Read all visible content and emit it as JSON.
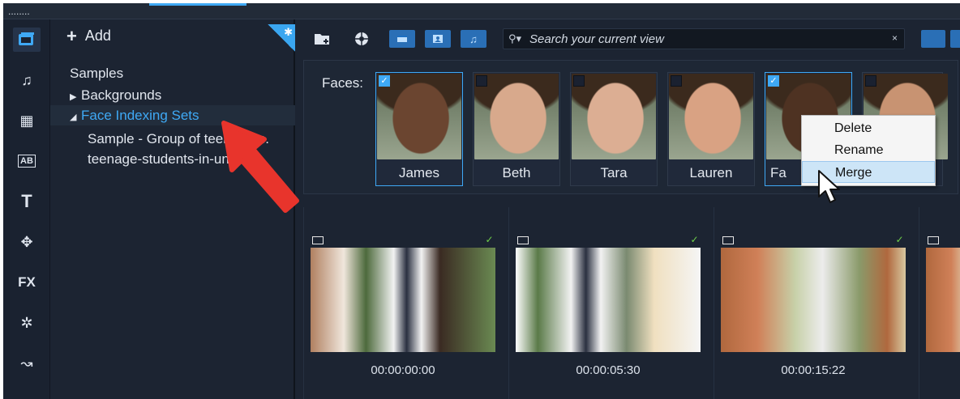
{
  "topbar": {
    "dots": "........"
  },
  "rail": {
    "items": [
      {
        "name": "media-library-icon",
        "glyph": "▤"
      },
      {
        "name": "music-icon",
        "glyph": "♫"
      },
      {
        "name": "instant-project-icon",
        "glyph": "▦"
      },
      {
        "name": "title-template-icon",
        "glyph": "AB"
      },
      {
        "name": "text-icon",
        "glyph": "T"
      },
      {
        "name": "graphics-icon",
        "glyph": "✥"
      },
      {
        "name": "fx-icon",
        "glyph": "FX"
      },
      {
        "name": "magic-wand-icon",
        "glyph": "✲"
      },
      {
        "name": "path-icon",
        "glyph": "↝"
      }
    ]
  },
  "library": {
    "add_label": "Add",
    "tree": [
      {
        "label": "Samples",
        "level": 1,
        "caret": "",
        "selected": false
      },
      {
        "label": "Backgrounds",
        "level": 1,
        "caret": "▶",
        "selected": false
      },
      {
        "label": "Face Indexing Sets",
        "level": 1,
        "caret": "◢",
        "selected": true
      },
      {
        "label": "Sample - Group of teenagers.",
        "level": 2,
        "caret": "",
        "selected": false
      },
      {
        "label": "teenage-students-in-uniform-",
        "level": 2,
        "caret": "",
        "selected": false
      }
    ]
  },
  "toolbar": {
    "search_placeholder": "Search your current view",
    "search_icon": "search-icon",
    "clear_glyph": "×"
  },
  "faces": {
    "label": "Faces:",
    "items": [
      {
        "name": "James",
        "checked": true,
        "tone": "#6b4530"
      },
      {
        "name": "Beth",
        "checked": false,
        "tone": "#d8a98c"
      },
      {
        "name": "Tara",
        "checked": false,
        "tone": "#dcae93"
      },
      {
        "name": "Lauren",
        "checked": false,
        "tone": "#d9a283"
      },
      {
        "name": "Fa",
        "checked": true,
        "tone": "#4e3222"
      },
      {
        "name": "",
        "checked": false,
        "tone": "#c89372"
      }
    ]
  },
  "context_menu": {
    "items": [
      {
        "label": "Delete",
        "highlighted": false
      },
      {
        "label": "Rename",
        "highlighted": false
      },
      {
        "label": "Merge",
        "highlighted": true
      }
    ]
  },
  "clips": [
    {
      "timecode": "00:00:00:00",
      "checked": true
    },
    {
      "timecode": "00:00:05:30",
      "checked": true
    },
    {
      "timecode": "00:00:15:22",
      "checked": true
    },
    {
      "timecode": "",
      "checked": false
    }
  ]
}
